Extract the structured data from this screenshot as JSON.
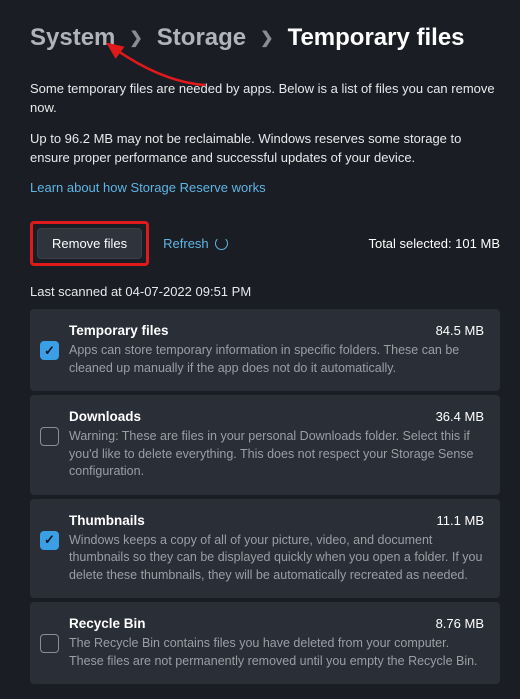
{
  "breadcrumb": {
    "system": "System",
    "storage": "Storage",
    "current": "Temporary files"
  },
  "intro1": "Some temporary files are needed by apps. Below is a list of files you can remove now.",
  "intro2": "Up to 96.2 MB may not be reclaimable. Windows reserves some storage to ensure proper performance and successful updates of your device.",
  "learn_link": "Learn about how Storage Reserve works",
  "remove_btn": "Remove files",
  "refresh": "Refresh",
  "total_label": "Total selected: 101 MB",
  "scanned": "Last scanned at 04-07-2022 09:51 PM",
  "items": [
    {
      "title": "Temporary files",
      "size": "84.5 MB",
      "desc": "Apps can store temporary information in specific folders. These can be cleaned up manually if the app does not do it automatically.",
      "checked": true
    },
    {
      "title": "Downloads",
      "size": "36.4 MB",
      "desc": "Warning: These are files in your personal Downloads folder. Select this if you'd like to delete everything. This does not respect your Storage Sense configuration.",
      "checked": false
    },
    {
      "title": "Thumbnails",
      "size": "11.1 MB",
      "desc": "Windows keeps a copy of all of your picture, video, and document thumbnails so they can be displayed quickly when you open a folder. If you delete these thumbnails, they will be automatically recreated as needed.",
      "checked": true
    },
    {
      "title": "Recycle Bin",
      "size": "8.76 MB",
      "desc": "The Recycle Bin contains files you have deleted from your computer. These files are not permanently removed until you empty the Recycle Bin.",
      "checked": false
    }
  ]
}
